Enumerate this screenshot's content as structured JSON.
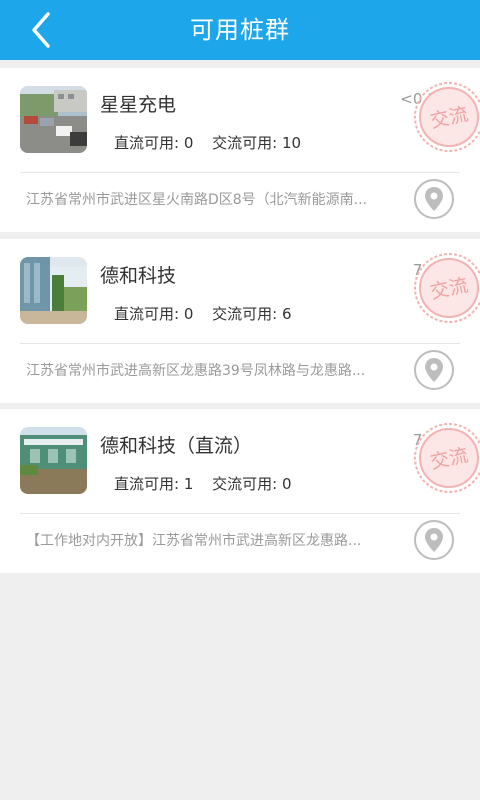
{
  "header": {
    "title": "可用桩群"
  },
  "stations": [
    {
      "name": "星星充电",
      "distance": "<0.1km",
      "dc_label": "直流可用: 0",
      "ac_label": "交流可用: 10",
      "stamp_text": "交流",
      "address": "江苏省常州市武进区星火南路D区8号（北汽新能源南..."
    },
    {
      "name": "德和科技",
      "distance": "7.0km",
      "dc_label": "直流可用: 0",
      "ac_label": "交流可用: 6",
      "stamp_text": "交流",
      "address": "江苏省常州市武进高新区龙惠路39号凤林路与龙惠路..."
    },
    {
      "name": "德和科技（直流）",
      "distance": "7.0km",
      "dc_label": "直流可用: 1",
      "ac_label": "交流可用: 0",
      "stamp_text": "交流",
      "address": "【工作地对内开放】江苏省常州市武进高新区龙惠路..."
    }
  ],
  "colors": {
    "header": "#1ea6ea",
    "stamp": "#f3b3b3",
    "divider": "#e6e6e6"
  },
  "icons": {
    "back": "chevron-left-icon",
    "location": "location-pin-icon"
  }
}
